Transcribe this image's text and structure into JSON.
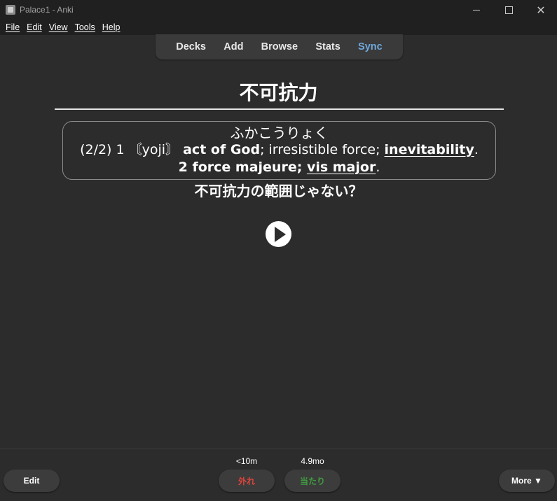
{
  "window": {
    "title": "Palace1 - Anki"
  },
  "menu": {
    "items": [
      "File",
      "Edit",
      "View",
      "Tools",
      "Help"
    ]
  },
  "toolbar": {
    "decks": "Decks",
    "add": "Add",
    "browse": "Browse",
    "stats": "Stats",
    "sync": "Sync"
  },
  "card": {
    "front": "不可抗力",
    "reading": "ふかこうりょく",
    "def_prefix": "(2/2) 1 〘yoji〙 ",
    "def_bold1": "act of God",
    "def_mid": "; irresistible force; ",
    "def_link1": "inevitability",
    "def_end1": ".",
    "def2_bold": "2 force majeure; ",
    "def2_link": "vis major",
    "def2_end": ".",
    "sentence": "不可抗力の範囲じゃない？"
  },
  "bottom": {
    "edit": "Edit",
    "more": "More ▼",
    "again_interval": "<10m",
    "again_label": "外れ",
    "good_interval": "4.9mo",
    "good_label": "当たり"
  },
  "colors": {
    "sync": "#6fa8dc",
    "again": "#e0453b",
    "good": "#3f9a3f"
  }
}
